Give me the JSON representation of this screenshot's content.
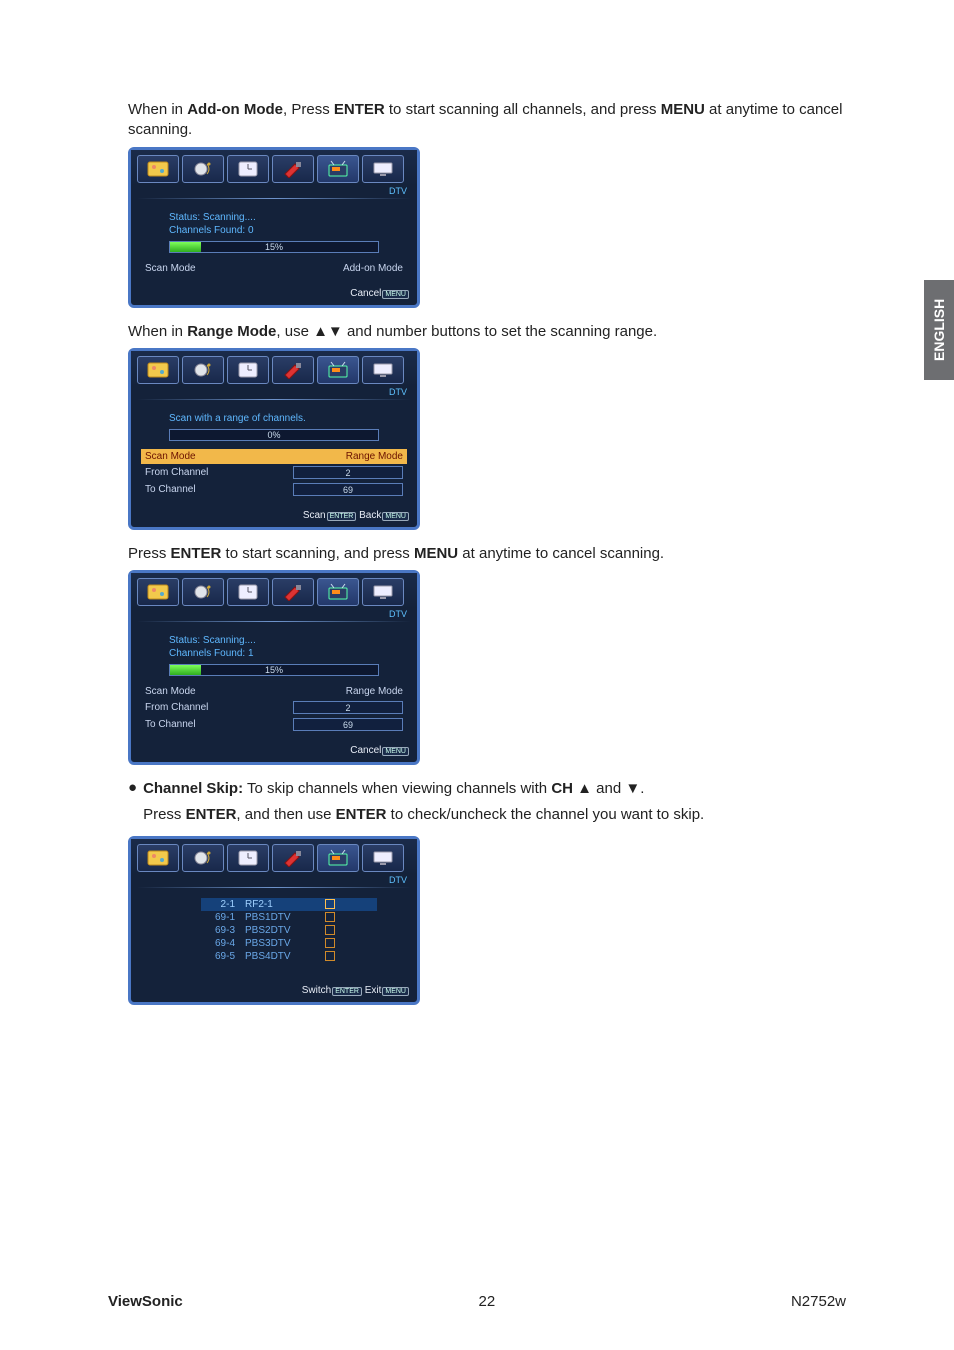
{
  "side_tab": "ENGLISH",
  "para1_a": "When in ",
  "para1_b": "Add-on Mode",
  "para1_c": ", Press ",
  "para1_d": "ENTER",
  "para1_e": " to start scanning all channels, and press ",
  "para1_f": "MENU",
  "para1_g": " at anytime to cancel scanning.",
  "para2_a": "When in ",
  "para2_b": "Range Mode",
  "para2_c": ", use ▲▼ and number buttons to set the scanning range.",
  "para3_a": "Press ",
  "para3_b": "ENTER",
  "para3_c": " to start scanning, and press ",
  "para3_d": "MENU",
  "para3_e": " at anytime to cancel scanning.",
  "bullet_a": "Channel Skip:",
  "bullet_b": " To skip channels when viewing channels with ",
  "bullet_c": "CH",
  "bullet_d": " ▲ and ▼.",
  "bullet_line2_a": "Press ",
  "bullet_line2_b": "ENTER",
  "bullet_line2_c": ", and then use ",
  "bullet_line2_d": "ENTER",
  "bullet_line2_e": " to check/uncheck the channel you want to skip.",
  "osd_dtv": "DTV",
  "osd1": {
    "status": "Status: Scanning....",
    "found": "Channels Found: 0",
    "progress_pct": 15,
    "progress_label": "15%",
    "scan_mode_label": "Scan Mode",
    "scan_mode_value": "Add-on Mode",
    "footer_cancel": "Cancel",
    "footer_key": "MENU"
  },
  "osd2": {
    "note": "Scan with a range of channels.",
    "progress_pct": 0,
    "progress_label": "0%",
    "rows": {
      "scan_mode": {
        "label": "Scan Mode",
        "value": "Range Mode"
      },
      "from": {
        "label": "From Channel",
        "value": "2"
      },
      "to": {
        "label": "To Channel",
        "value": "69"
      }
    },
    "footer_scan": "Scan",
    "footer_key1": "ENTER",
    "footer_back": "Back",
    "footer_key2": "MENU"
  },
  "osd3": {
    "status": "Status: Scanning....",
    "found": "Channels Found: 1",
    "progress_pct": 15,
    "progress_label": "15%",
    "rows": {
      "scan_mode": {
        "label": "Scan Mode",
        "value": "Range Mode"
      },
      "from": {
        "label": "From Channel",
        "value": "2"
      },
      "to": {
        "label": "To Channel",
        "value": "69"
      }
    },
    "footer_cancel": "Cancel",
    "footer_key": "MENU"
  },
  "osd4": {
    "channels": [
      {
        "num": "2-1",
        "name": "RF2-1",
        "sel": true
      },
      {
        "num": "69-1",
        "name": "PBS1DTV",
        "sel": false
      },
      {
        "num": "69-3",
        "name": "PBS2DTV",
        "sel": false
      },
      {
        "num": "69-4",
        "name": "PBS3DTV",
        "sel": false
      },
      {
        "num": "69-5",
        "name": "PBS4DTV",
        "sel": false
      }
    ],
    "footer_switch": "Switch",
    "footer_key1": "ENTER",
    "footer_exit": "Exit",
    "footer_key2": "MENU"
  },
  "footer": {
    "brand": "ViewSonic",
    "page": "22",
    "model": "N2752w"
  }
}
